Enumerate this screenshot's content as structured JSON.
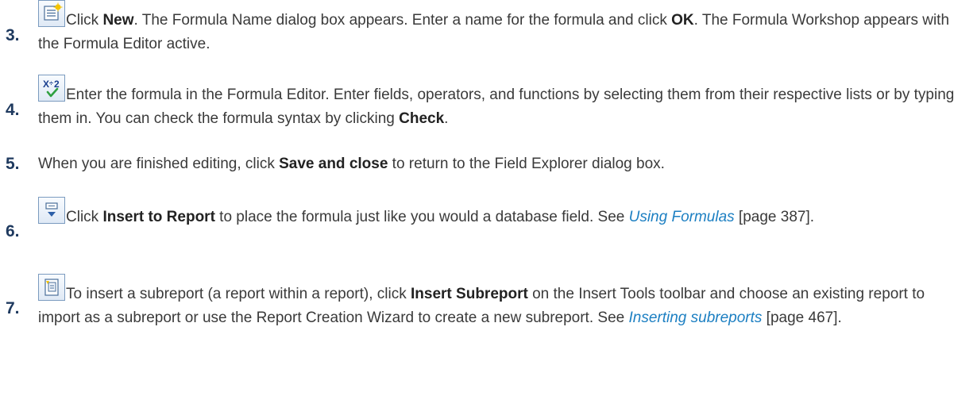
{
  "steps": [
    {
      "number": "3.",
      "icon": "new-formula-icon",
      "t1": "Click ",
      "b1": "New",
      "t2": ". The Formula Name dialog box appears. Enter a name for the formula and click ",
      "b2": "OK",
      "t3": ". The Formula Workshop appears with the Formula Editor active."
    },
    {
      "number": "4.",
      "icon": "check-formula-icon",
      "t1": "Enter the formula in the Formula Editor. Enter fields, operators, and functions by selecting them from their respective lists or by typing them in. You can check the formula syntax by clicking ",
      "b1": "Check",
      "t2": "."
    },
    {
      "number": "5.",
      "t1": "When you are finished editing, click ",
      "b1": "Save and close",
      "t2": " to return to the Field Explorer dialog box."
    },
    {
      "number": "6.",
      "icon": "insert-to-report-icon",
      "t1": "Click ",
      "b1": "Insert to Report",
      "t2": " to place the formula just like you would a database field. See ",
      "link": "Using Formulas",
      "t3": " [page 387]."
    },
    {
      "number": "7.",
      "icon": "insert-subreport-icon",
      "t1": "To insert a subreport (a report within a report), click ",
      "b1": "Insert Subreport",
      "t2": " on the Insert Tools toolbar and choose an existing report to import as a subreport or use the Report Creation Wizard to create a new subreport. See ",
      "link": "Inserting subreports",
      "t3": " [page 467]."
    }
  ]
}
